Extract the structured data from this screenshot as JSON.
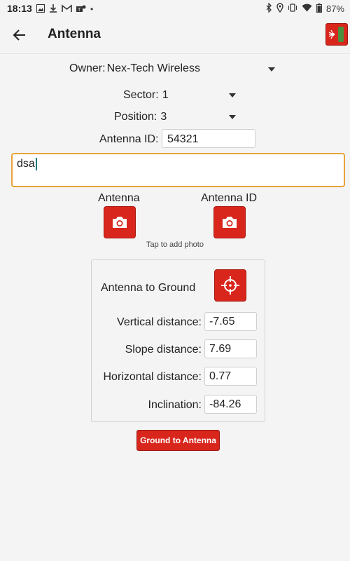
{
  "status_bar": {
    "time": "18:13",
    "battery": "87%",
    "left_icons": [
      "image-icon",
      "download-icon",
      "gmail-icon",
      "teams-icon",
      "dot-icon"
    ],
    "right_icons": [
      "bluetooth-icon",
      "location-icon",
      "vibrate-icon",
      "wifi-icon",
      "battery-icon"
    ]
  },
  "app_bar": {
    "title": "Antenna"
  },
  "form": {
    "owner_label": "Owner:",
    "owner_value": "Nex-Tech Wireless",
    "sector_label": "Sector:",
    "sector_value": "1",
    "position_label": "Position:",
    "position_value": "3",
    "antenna_id_label": "Antenna ID:",
    "antenna_id_value": "54321",
    "notes_value": "dsa"
  },
  "photos": {
    "antenna_label": "Antenna",
    "antenna_id_label": "Antenna ID",
    "hint": "Tap to add photo"
  },
  "measurements": {
    "title": "Antenna to Ground",
    "rows": [
      {
        "label": "Vertical distance:",
        "value": "-7.65"
      },
      {
        "label": "Slope distance:",
        "value": "7.69"
      },
      {
        "label": "Horizontal distance:",
        "value": "0.77"
      },
      {
        "label": "Inclination:",
        "value": "-84.26"
      }
    ]
  },
  "ground_button": "Ground to Antenna",
  "colors": {
    "accent": "#d9261c",
    "focus_border": "#e8a33a",
    "background": "#f4f4f4"
  }
}
